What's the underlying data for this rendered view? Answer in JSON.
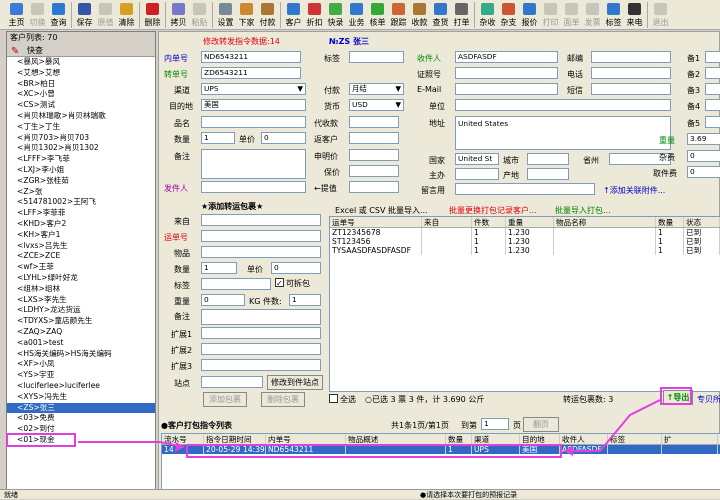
{
  "toolbar": [
    {
      "label": "主页",
      "icon": "home-icon",
      "color": "#3a7bd5",
      "enabled": true
    },
    {
      "label": "切换",
      "icon": "switch-icon",
      "color": "#888888",
      "enabled": false
    },
    {
      "label": "查询",
      "icon": "search-icon",
      "color": "#2a7ad5",
      "enabled": true
    },
    {
      "sep": true
    },
    {
      "label": "保存",
      "icon": "save-icon",
      "color": "#3355aa",
      "enabled": true
    },
    {
      "label": "原值",
      "icon": "undo-icon",
      "color": "#888888",
      "enabled": false
    },
    {
      "label": "清除",
      "icon": "clear-icon",
      "color": "#d8a020",
      "enabled": true
    },
    {
      "sep": true
    },
    {
      "label": "删除",
      "icon": "delete-icon",
      "color": "#cc2222",
      "enabled": true
    },
    {
      "sep": true
    },
    {
      "label": "拷贝",
      "icon": "copy-icon",
      "color": "#7777cc",
      "enabled": true
    },
    {
      "label": "粘贴",
      "icon": "paste-icon",
      "color": "#888888",
      "enabled": false
    },
    {
      "sep": true
    },
    {
      "label": "设置",
      "icon": "settings-icon",
      "color": "#778899",
      "enabled": true
    },
    {
      "label": "下家",
      "icon": "next-party-icon",
      "color": "#cc8833",
      "enabled": true
    },
    {
      "label": "付款",
      "icon": "payment-icon",
      "color": "#aa7733",
      "enabled": true
    },
    {
      "sep": true
    },
    {
      "label": "客户",
      "icon": "customer-icon",
      "color": "#3377cc",
      "enabled": true
    },
    {
      "label": "折扣",
      "icon": "discount-icon",
      "color": "#cc3333",
      "enabled": true
    },
    {
      "label": "快录",
      "icon": "quick-entry-icon",
      "color": "#44aa44",
      "enabled": true
    },
    {
      "label": "业务",
      "icon": "business-icon",
      "color": "#3377cc",
      "enabled": true
    },
    {
      "label": "核单",
      "icon": "verify-icon",
      "color": "#33aa33",
      "enabled": true
    },
    {
      "label": "跟踪",
      "icon": "track-icon",
      "color": "#cc6633",
      "enabled": true
    },
    {
      "label": "收款",
      "icon": "receive-icon",
      "color": "#aa7733",
      "enabled": true
    },
    {
      "label": "查货",
      "icon": "check-goods-icon",
      "color": "#3377cc",
      "enabled": true
    },
    {
      "label": "打单",
      "icon": "print-bill-icon",
      "color": "#666666",
      "enabled": true
    },
    {
      "sep": true
    },
    {
      "label": "杂收",
      "icon": "misc-income-icon",
      "color": "#33aa88",
      "enabled": true
    },
    {
      "label": "杂支",
      "icon": "misc-expense-icon",
      "color": "#cc5533",
      "enabled": true
    },
    {
      "label": "报价",
      "icon": "quote-icon",
      "color": "#3377cc",
      "enabled": true
    },
    {
      "label": "打印",
      "icon": "print-icon",
      "color": "#888888",
      "enabled": false
    },
    {
      "label": "面单",
      "icon": "waybill-icon",
      "color": "#888888",
      "enabled": false
    },
    {
      "label": "发票",
      "icon": "invoice-icon",
      "color": "#888888",
      "enabled": false
    },
    {
      "label": "标签",
      "icon": "tag-icon",
      "color": "#3377cc",
      "enabled": true
    },
    {
      "label": "来电",
      "icon": "phone-icon",
      "color": "#333333",
      "enabled": true
    },
    {
      "sep": true
    },
    {
      "label": "退出",
      "icon": "exit-icon",
      "color": "#888888",
      "enabled": false
    }
  ],
  "customer_list": {
    "header": "客户列表: 70",
    "quick_search": "快查",
    "items": [
      "<暴风>暴风",
      "<艾想>艾想",
      "<BR>柏日",
      "<XC>小曾",
      "<CS>测试",
      "<肖贝林瑞歌>肖贝林瑞歌",
      "<丁生>丁生",
      "<肖贝703>肖贝703",
      "<肖贝1302>肖贝1302",
      "<LFFF>李飞菲",
      "<LXJ>李小姐",
      "<ZGR>张桂茹",
      "<Z>张",
      "<514781002>王阿飞",
      "<LFF>李菲菲",
      "<KHD>客户2",
      "<KH>客户1",
      "<lvxs>吕先生",
      "<ZCE>ZCE",
      "<wf>王菲",
      "<LYHL>绿叶好龙",
      "<组林>组林",
      "<LXS>李先生",
      "<LDHY>龙达货运",
      "<TDYXS>童店颜先生",
      "<ZAQ>ZAQ",
      "<a001>test",
      "<HS海关编码>HS海关编码",
      "<XF>小凤",
      "<YS>宇亚",
      "<luciferlee>luciferlee",
      "<XYS>冯先生",
      "<ZS>张三",
      "<03>免费",
      "<02>到付",
      "<01>现金"
    ],
    "selected_index": 32
  },
  "form": {
    "alert": "修改转发指令数据:14",
    "badge": "№ZS 张三",
    "waybill_label": "内单号",
    "waybill_value": "ND6543211",
    "transfer_label": "转单号",
    "transfer_value": "ZD6543211",
    "channel_label": "渠道",
    "channel_value": "UPS",
    "dest_label": "目的地",
    "dest_value": "美国",
    "name_label": "品名",
    "qty_label": "数量",
    "qty_value": "1",
    "price_label": "单价",
    "price_value": "0",
    "note_label": "备注",
    "sender_label": "发件人",
    "tag_label": "标签",
    "pay_label": "付款",
    "pay_value": "月结",
    "currency_label": "货币",
    "currency_value": "USD",
    "cod_label": "代收款",
    "inc_label": "返客户",
    "declared_label": "申明价",
    "insured_label": "保价",
    "retrieve_label": "←提值",
    "receiver_label": "收件人",
    "receiver_value": "ASDFASDF",
    "zip_label": "邮编",
    "idno_label": "证照号",
    "tel_label": "电话",
    "email_label": "E-Mail",
    "sms_label": "短信",
    "unit_label": "单位",
    "addr_label": "地址",
    "addr_value": "United States",
    "country_label": "国家",
    "country_value": "United St",
    "city_label": "城市",
    "province_label": "省州",
    "main_label": "主办",
    "origin_label": "产地",
    "store_label": "留言用",
    "extra_labels": [
      "备1",
      "备2",
      "备3",
      "备4",
      "备5"
    ],
    "weight_label": "重量",
    "weight_value": "3.69",
    "misc_label": "杂费",
    "misc_value": "0",
    "pickup_label": "取件费",
    "pickup_value": "0",
    "attach_link": "↑添加关联附件..."
  },
  "package": {
    "title": "★添加转运包裹★",
    "from_label": "来自",
    "shipno_label": "运单号",
    "item_label": "物品",
    "qty_label": "数量",
    "qty_value": "1",
    "price_label": "单价",
    "price_value": "0",
    "tag_label": "标签",
    "split_label": "可拆包",
    "weight_label": "重量",
    "weight_value": "0",
    "kg_label": "KG 件数:",
    "kg_value": "1",
    "note_label": "备注",
    "ext1_label": "扩展1",
    "ext2_label": "扩展2",
    "ext3_label": "扩展3",
    "site_label": "站点",
    "edit_site_btn": "修改到件站点",
    "add_btn": "添加包裹",
    "del_btn": "删除包裹"
  },
  "import_bar": {
    "excel": "Excel 或 CSV 批量导入...",
    "batch": "批量更换打包记录客户...",
    "batch_import": "批量导入打包..."
  },
  "pkg_table": {
    "columns": [
      "运单号",
      "来自",
      "件数",
      "重量",
      "物品名称",
      "数量",
      "状态"
    ],
    "rows": [
      [
        "ZT12345678",
        "",
        "1",
        "1.230",
        "",
        "1",
        "已到"
      ],
      [
        "ST123456",
        "",
        "1",
        "1.230",
        "",
        "1",
        "已到"
      ],
      [
        "TYSAASDFASDFASDF",
        "",
        "1",
        "1.230",
        "",
        "1",
        "已到"
      ]
    ]
  },
  "summary": {
    "select_all": "全选",
    "selected_text": "○已选 3 票 3 件，计 3.690 公斤",
    "count_text": "转运包裹数: 3",
    "export_btn": "↑导出",
    "more": "专贝所"
  },
  "customer_orders": {
    "title": "●客户打包指令列表",
    "paging": "共1条1页/第1页",
    "goto_label": "到第",
    "goto_value": "1",
    "page_label": "页",
    "nav_btn": "翻页",
    "columns": [
      "流水号",
      "指令日期时间",
      "内单号",
      "物品概述",
      "数量",
      "渠道",
      "目的地",
      "收件人",
      "标签",
      "扩"
    ],
    "rows": [
      [
        "14",
        "20-05-29 14:39",
        "ND6543211",
        "",
        "1",
        "UPS",
        "美国",
        "ASDFASDF",
        "",
        ""
      ]
    ]
  },
  "status_bar": {
    "left": "就绪",
    "right": "●请选择本次要打包的预报记录"
  },
  "colors": {
    "accent": "#316ac5",
    "highlight": "#e040e0",
    "alert": "#e0000b",
    "label_blue": "#0000cc",
    "label_green": "#008800"
  }
}
